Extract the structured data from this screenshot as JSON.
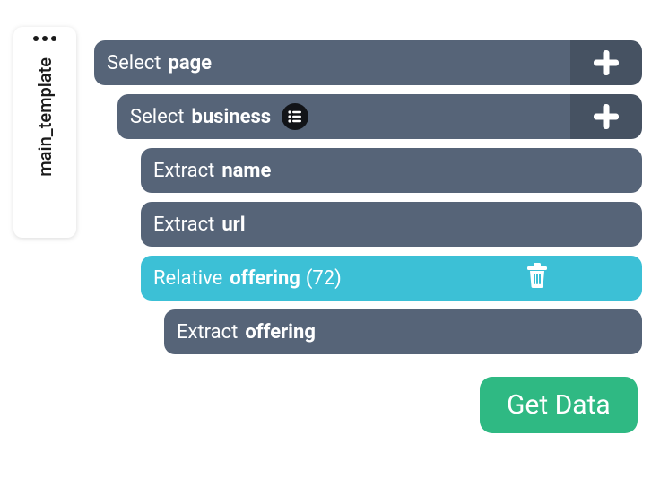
{
  "sidebar": {
    "tab_label": "main_template"
  },
  "rows": [
    {
      "verb": "Select",
      "noun": "page",
      "add": true,
      "list_badge": false,
      "selected": false,
      "indent": 0,
      "count": null,
      "trash": false
    },
    {
      "verb": "Select",
      "noun": "business",
      "add": true,
      "list_badge": true,
      "selected": false,
      "indent": 1,
      "count": null,
      "trash": false
    },
    {
      "verb": "Extract",
      "noun": "name",
      "add": false,
      "list_badge": false,
      "selected": false,
      "indent": 2,
      "count": null,
      "trash": false
    },
    {
      "verb": "Extract",
      "noun": "url",
      "add": false,
      "list_badge": false,
      "selected": false,
      "indent": 2,
      "count": null,
      "trash": false
    },
    {
      "verb": "Relative",
      "noun": "offering",
      "add": false,
      "list_badge": false,
      "selected": true,
      "indent": 2,
      "count": "(72)",
      "trash": true
    },
    {
      "verb": "Extract",
      "noun": "offering",
      "add": false,
      "list_badge": false,
      "selected": false,
      "indent": 3,
      "count": null,
      "trash": false
    }
  ],
  "buttons": {
    "get_data": "Get Data"
  },
  "colors": {
    "row_bg": "#566478",
    "row_selected_bg": "#3cc0d6",
    "primary_button": "#2fb983"
  }
}
